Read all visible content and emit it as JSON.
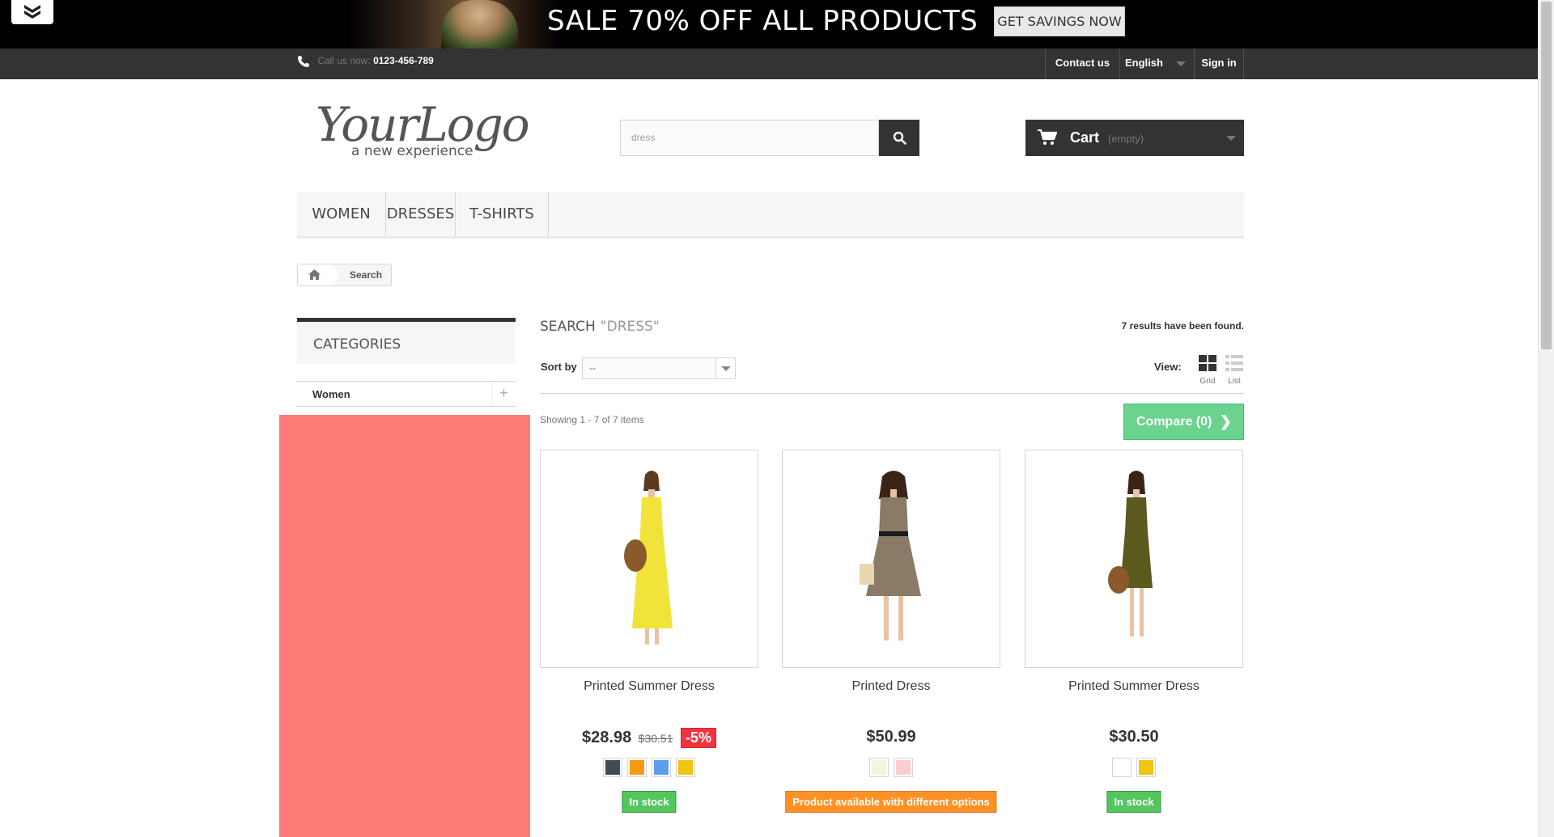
{
  "banner": {
    "title": "SALE 70% OFF ALL PRODUCTS",
    "button": "GET SAVINGS NOW"
  },
  "topnav": {
    "call_label": "Call us now:",
    "phone": "0123-456-789",
    "contact": "Contact us",
    "language": "English",
    "signin": "Sign in"
  },
  "header": {
    "logo_main": "YourLogo",
    "logo_sub": "a new experience",
    "search_value": "dress",
    "cart_label": "Cart",
    "cart_status": "(empty)"
  },
  "menu": [
    "WOMEN",
    "DRESSES",
    "T-SHIRTS"
  ],
  "breadcrumb": {
    "current": "Search"
  },
  "sidebar": {
    "title": "CATEGORIES",
    "items": [
      {
        "label": "Women",
        "toggle": "+"
      }
    ]
  },
  "main": {
    "heading": "SEARCH",
    "query": "\"DRESS\"",
    "results_count": "7 results have been found.",
    "sort_label": "Sort by",
    "sort_value": "--",
    "view_label": "View:",
    "view_grid": "Grid",
    "view_list": "List",
    "showing": "Showing 1 - 7 of 7 items",
    "compare": "Compare (0)"
  },
  "products": [
    {
      "name": "Printed Summer Dress",
      "price": "$28.98",
      "old_price": "$30.51",
      "reduction": "-5%",
      "colors": [
        "#434a54",
        "#f39c11",
        "#5d9cec",
        "#f1c40f"
      ],
      "availability": "In stock",
      "dress_color": "#f2e33a"
    },
    {
      "name": "Printed Dress",
      "price": "$50.99",
      "colors": [
        "#f5f5dc",
        "#fcced3"
      ],
      "availability": "Product available with different options",
      "dress_color": "#8a7a66"
    },
    {
      "name": "Printed Summer Dress",
      "price": "$30.50",
      "colors": [
        "#ffffff",
        "#f1c40f"
      ],
      "availability": "In stock",
      "dress_color": "#5a5a1e"
    }
  ],
  "colors": {
    "dark": "#333333",
    "compare": "#6ad38e",
    "in_stock": "#55c65e",
    "options": "#fe9126",
    "reduction": "#f13340",
    "overlay": "#ff7b78"
  }
}
